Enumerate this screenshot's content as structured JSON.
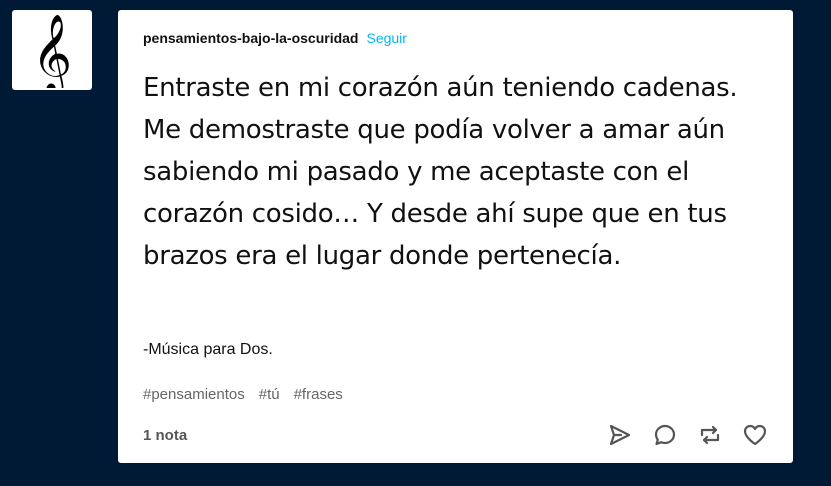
{
  "avatar": {
    "icon": "treble-clef-icon"
  },
  "post": {
    "blog_name": "pensamientos-bajo-la-oscuridad",
    "follow_label": "Seguir",
    "quote_text": "Entraste en mi corazón aún teniendo cadenas. Me demostraste que podía volver a amar aún sabiendo mi pasado y me aceptaste con el corazón cosido… Y desde ahí supe que en tus brazos era el lugar donde pertenecía.",
    "quote_source": "-Música para Dos.",
    "tags": [
      "#pensamientos",
      "#tú",
      "#frases"
    ],
    "notes_label": "1 nota",
    "actions": [
      "share-icon",
      "reply-icon",
      "reblog-icon",
      "like-icon"
    ]
  },
  "colors": {
    "background": "#001935",
    "follow_link": "#00b8ff",
    "tag_text": "#666666",
    "icon_stroke": "#555555"
  }
}
